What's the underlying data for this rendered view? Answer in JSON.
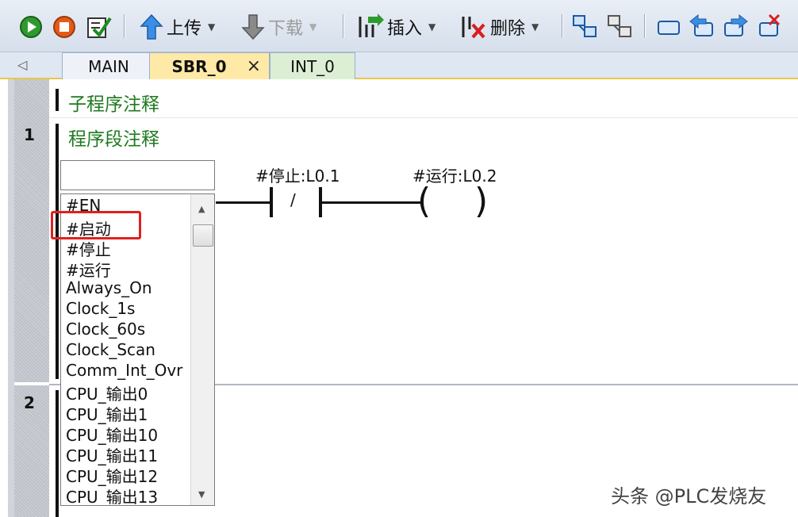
{
  "toolbar": {
    "upload_label": "上传",
    "download_label": "下载",
    "insert_label": "插入",
    "delete_label": "删除"
  },
  "tabs": [
    {
      "label": "MAIN"
    },
    {
      "label": "SBR_0",
      "close": "×"
    },
    {
      "label": "INT_0"
    }
  ],
  "editor": {
    "subroutine_comment": "子程序注释",
    "networks": [
      {
        "number": "1",
        "comment": "程序段注释"
      },
      {
        "number": "2"
      }
    ]
  },
  "ladder": {
    "contact_label": "#停止:L0.1",
    "contact_symbol": "/",
    "coil_label": "#运行:L0.2"
  },
  "autocomplete": {
    "input_value": "",
    "items": [
      "#EN",
      "#启动",
      "#停止",
      "#运行",
      "Always_On",
      "Clock_1s",
      "Clock_60s",
      "Clock_Scan",
      "Comm_Int_Ovr",
      "CPU_输出0",
      "CPU_输出1",
      "CPU_输出10",
      "CPU_输出11",
      "CPU_输出12",
      "CPU_输出13"
    ],
    "highlighted": "#启动"
  },
  "watermark": "头条 @PLC发烧友",
  "colors": {
    "comment_green": "#1f7a1f",
    "highlight_red": "#e02020",
    "active_tab": "#ffe9a6"
  }
}
